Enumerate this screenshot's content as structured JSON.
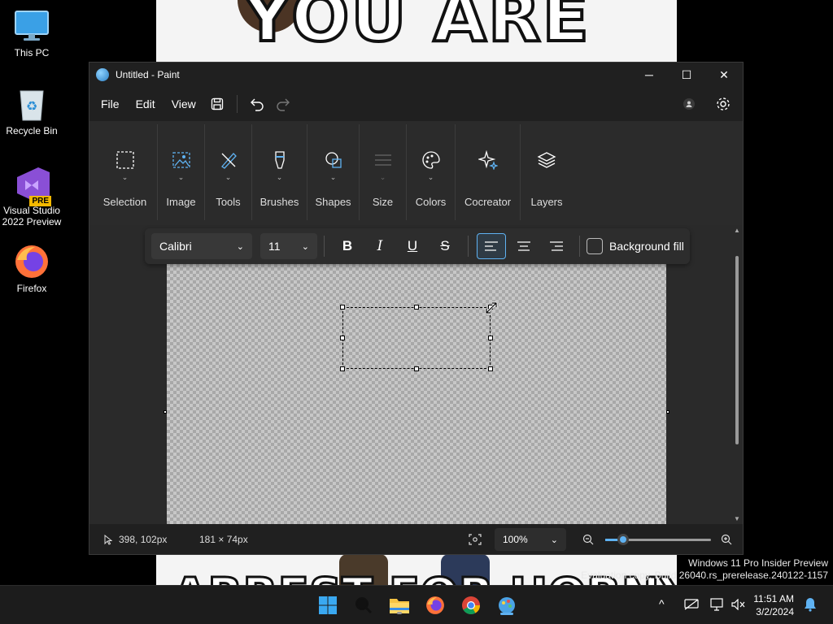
{
  "wallpaper": {
    "top_text": "YOU ARE",
    "bottom_text": "ARREST FOR HORNY"
  },
  "desktop": {
    "icons": [
      {
        "label": "This PC",
        "icon": "monitor-icon"
      },
      {
        "label": "Recycle Bin",
        "icon": "recycle-bin-icon"
      },
      {
        "label": "Visual Studio 2022 Preview",
        "icon": "visual-studio-icon",
        "badge": "PRE"
      },
      {
        "label": "Firefox",
        "icon": "firefox-icon"
      }
    ]
  },
  "window": {
    "title": "Untitled - Paint",
    "controls": {
      "minimize": "─",
      "maximize": "☐",
      "close": "✕"
    }
  },
  "menu": {
    "file": "File",
    "edit": "Edit",
    "view": "View"
  },
  "ribbon": {
    "groups": [
      {
        "label": "Selection",
        "icon": "selection-icon",
        "dropdown": true
      },
      {
        "label": "Image",
        "icon": "image-icon",
        "dropdown": true
      },
      {
        "label": "Tools",
        "icon": "tools-icon",
        "dropdown": true
      },
      {
        "label": "Brushes",
        "icon": "brush-icon",
        "dropdown": true
      },
      {
        "label": "Shapes",
        "icon": "shapes-icon",
        "dropdown": true
      },
      {
        "label": "Size",
        "icon": "size-icon",
        "dropdown": true,
        "disabled": true
      },
      {
        "label": "Colors",
        "icon": "palette-icon",
        "dropdown": true
      },
      {
        "label": "Cocreator",
        "icon": "sparkle-icon",
        "dropdown": false
      },
      {
        "label": "Layers",
        "icon": "layers-icon",
        "dropdown": false
      }
    ]
  },
  "text_toolbar": {
    "font": "Calibri",
    "size": "11",
    "bold": "B",
    "italic": "I",
    "underline": "U",
    "strikethrough": "S",
    "alignment": "left",
    "background_fill_label": "Background fill",
    "background_fill_checked": false
  },
  "status": {
    "cursor_position": "398, 102px",
    "selection_size": "181 × 74px",
    "zoom": "100%",
    "zoom_slider_fraction": 0.17
  },
  "watermark": {
    "line1": "Windows 11 Pro Insider Preview",
    "line2": "Evaluation copy. Build 26040.rs_prerelease.240122-1157"
  },
  "taskbar": {
    "time": "11:51 AM",
    "date": "3/2/2024"
  },
  "colors": {
    "accent": "#5fb2f2",
    "window_bg": "#202020",
    "ribbon_bg": "#2b2b2b"
  }
}
